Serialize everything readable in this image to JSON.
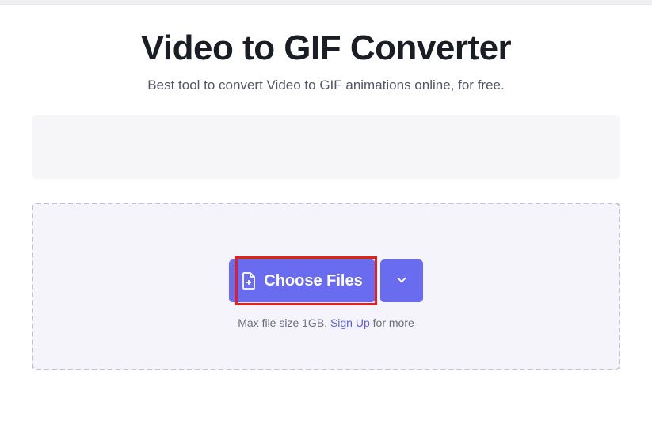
{
  "header": {
    "title": "Video to GIF Converter",
    "subtitle": "Best tool to convert Video to GIF animations online, for free."
  },
  "upload": {
    "choose_label": "Choose Files",
    "info_prefix": "Max file size 1GB. ",
    "signup_text": "Sign Up",
    "info_suffix": " for more"
  },
  "colors": {
    "primary": "#6a6cf0",
    "highlight": "#e3201e"
  }
}
